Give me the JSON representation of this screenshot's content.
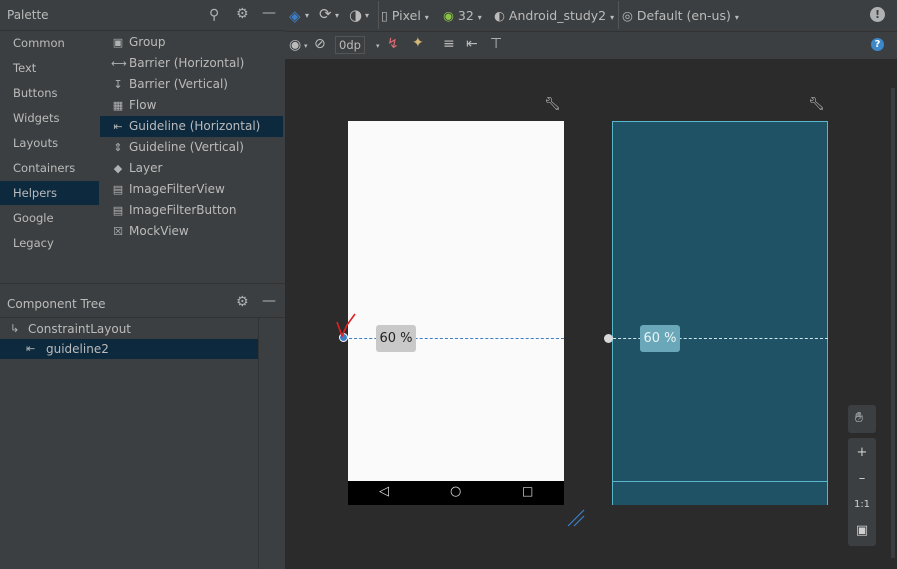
{
  "palette": {
    "title": "Palette",
    "categories": [
      {
        "label": "Common",
        "selected": false
      },
      {
        "label": "Text",
        "selected": false
      },
      {
        "label": "Buttons",
        "selected": false
      },
      {
        "label": "Widgets",
        "selected": false
      },
      {
        "label": "Layouts",
        "selected": false
      },
      {
        "label": "Containers",
        "selected": false
      },
      {
        "label": "Helpers",
        "selected": true
      },
      {
        "label": "Google",
        "selected": false
      },
      {
        "label": "Legacy",
        "selected": false
      }
    ],
    "items": [
      {
        "label": "Group",
        "icon": "group-icon",
        "selected": false
      },
      {
        "label": "Barrier (Horizontal)",
        "icon": "barrier-horizontal-icon",
        "selected": false
      },
      {
        "label": "Barrier (Vertical)",
        "icon": "barrier-vertical-icon",
        "selected": false
      },
      {
        "label": "Flow",
        "icon": "flow-icon",
        "selected": false
      },
      {
        "label": "Guideline (Horizontal)",
        "icon": "guideline-horizontal-icon",
        "selected": true
      },
      {
        "label": "Guideline (Vertical)",
        "icon": "guideline-vertical-icon",
        "selected": false
      },
      {
        "label": "Layer",
        "icon": "layer-icon",
        "selected": false
      },
      {
        "label": "ImageFilterView",
        "icon": "image-icon",
        "selected": false
      },
      {
        "label": "ImageFilterButton",
        "icon": "image-icon",
        "selected": false
      },
      {
        "label": "MockView",
        "icon": "mockview-icon",
        "selected": false
      }
    ]
  },
  "component_tree": {
    "title": "Component Tree",
    "rows": [
      {
        "label": "ConstraintLayout",
        "icon": "constraint-layout-icon",
        "selected": false
      },
      {
        "label": "guideline2",
        "icon": "guideline-horizontal-icon",
        "selected": true
      }
    ]
  },
  "toolbar": {
    "device": "Pixel",
    "api_level": "32",
    "theme": "Android_study2",
    "locale": "Default (en-us)",
    "default_margin": "0dp"
  },
  "design": {
    "guideline_percent_label": "60 %",
    "blueprint_percent_label": "60 %",
    "accent_color": "#3d7fc7",
    "blueprint_color": "#1f5264"
  },
  "zoom": {
    "reset_label": "1:1"
  }
}
